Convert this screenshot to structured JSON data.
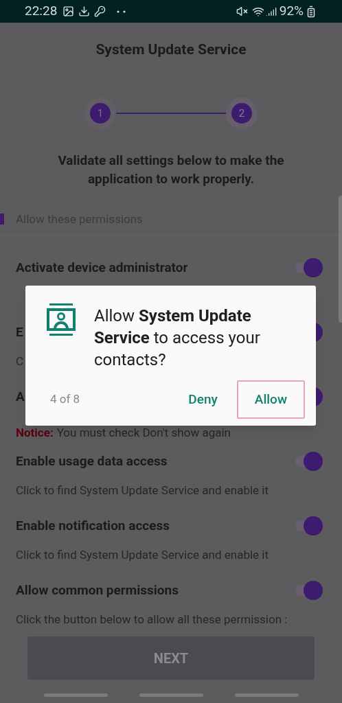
{
  "status_bar": {
    "time": "22:28",
    "battery": "92%"
  },
  "title": "System Update Service",
  "stepper": [
    {
      "label": "1",
      "selected": false
    },
    {
      "label": "2",
      "selected": true
    }
  ],
  "heading": "Validate all settings below to make the application to work properly.",
  "section": "Allow these permissions",
  "items": [
    {
      "title": "Activate device administrator",
      "on": true
    },
    {
      "title": "E",
      "description": "C",
      "on": true
    },
    {
      "title": "A",
      "notice_label": "Notice:",
      "notice_text": "You must check Don't show again",
      "on": true
    },
    {
      "title": "Enable usage data access",
      "description": "Click to find System Update Service and enable it",
      "on": true
    },
    {
      "title": "Enable notification access",
      "description": "Click to find System Update Service and enable it",
      "on": true
    },
    {
      "title": "Allow common permissions",
      "description": "Click the button below to allow all these permission :",
      "on": true
    }
  ],
  "next_button": {
    "label": "NEXT",
    "disabled": true
  },
  "dialog": {
    "message": "Allow **System Update Service** to access your contacts?",
    "counter": "4 of 8",
    "buttons": [
      {
        "label": "Deny",
        "selected": false
      },
      {
        "label": "Allow",
        "selected": true
      }
    ]
  }
}
